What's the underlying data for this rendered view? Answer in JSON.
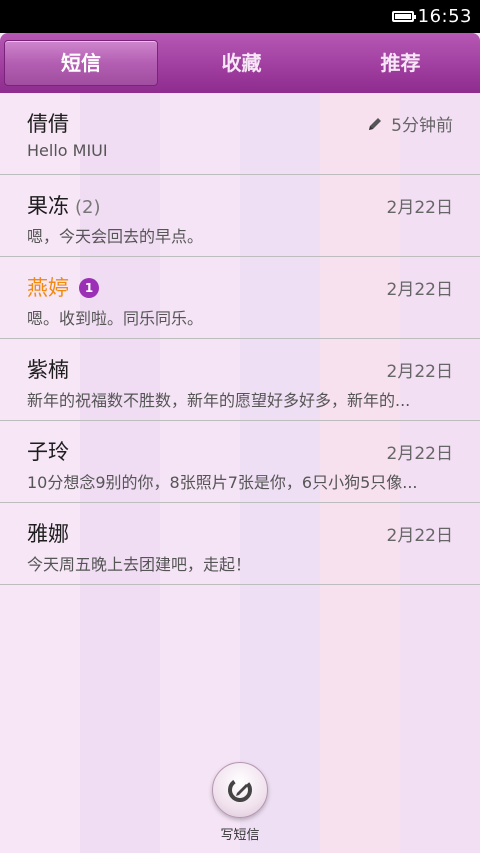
{
  "status_bar": {
    "time": "16:53",
    "battery_icon": "battery-icon"
  },
  "tabs": [
    {
      "label": "短信",
      "active": true
    },
    {
      "label": "收藏",
      "active": false
    },
    {
      "label": "推荐",
      "active": false
    }
  ],
  "conversations": [
    {
      "name": "倩倩",
      "count": "",
      "badge": "",
      "preview": "Hello MIUI",
      "time": "5分钟前",
      "draft_icon": "pencil-icon",
      "name_color": "#1d1d1d"
    },
    {
      "name": "果冻",
      "count": "(2)",
      "badge": "",
      "preview": "嗯，今天会回去的早点。",
      "time": "2月22日",
      "name_color": "#1d1d1d"
    },
    {
      "name": "燕婷",
      "count": "",
      "badge": "1",
      "preview": "嗯。收到啦。同乐同乐。",
      "time": "2月22日",
      "name_color": "#f18a0f"
    },
    {
      "name": "紫楠",
      "count": "",
      "badge": "",
      "preview": "新年的祝福数不胜数，新年的愿望好多好多，新年的...",
      "time": "2月22日",
      "name_color": "#1d1d1d"
    },
    {
      "name": "子玲",
      "count": "",
      "badge": "",
      "preview": "10分想念9别的你，8张照片7张是你，6只小狗5只像...",
      "time": "2月22日",
      "name_color": "#1d1d1d"
    },
    {
      "name": "雅娜",
      "count": "",
      "badge": "",
      "preview": "今天周五晚上去团建吧，走起！",
      "time": "2月22日",
      "name_color": "#1d1d1d"
    }
  ],
  "compose": {
    "label": "写短信",
    "icon": "compose-icon"
  },
  "colors": {
    "accent": "#a03fa0",
    "unread_badge": "#9b2fb5",
    "highlight_name": "#f18a0f"
  }
}
